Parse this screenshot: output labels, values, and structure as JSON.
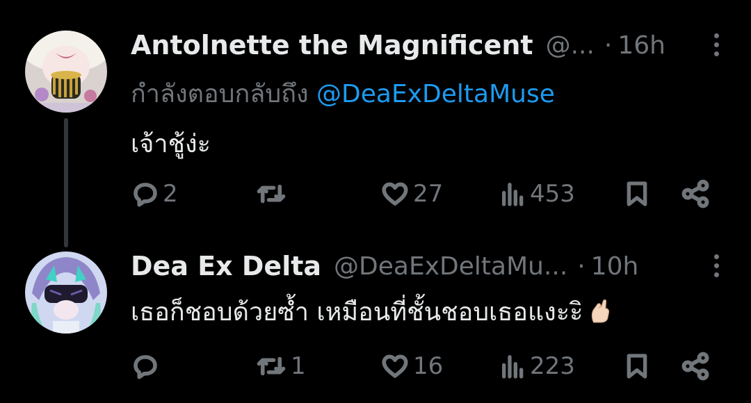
{
  "tweets": [
    {
      "name": "Antolnette the Magnificent",
      "handle": "@...",
      "dot": "·",
      "time": "16h",
      "replying_prefix": "กำลังตอบกลับถึง",
      "replying_mention": "@DeaExDeltaMuse",
      "text": "เจ้าชู้ง่ะ",
      "replies": "2",
      "retweets": "",
      "likes": "27",
      "views": "453"
    },
    {
      "name": "Dea Ex Delta",
      "handle": "@DeaExDeltaMu...",
      "dot": "·",
      "time": "10h",
      "text": "เธอก็ชอบด้วยซ้ำ เหมือนที่ชั้นชอบเธอแงะะิ",
      "emoji": "pinched-fingers-emoji",
      "replies": "",
      "retweets": "1",
      "likes": "16",
      "views": "223"
    }
  ],
  "colors": {
    "background": "#000000",
    "text": "#e7e9ea",
    "muted": "#71767b",
    "link": "#1d9bf0",
    "thread_line": "#333639"
  }
}
